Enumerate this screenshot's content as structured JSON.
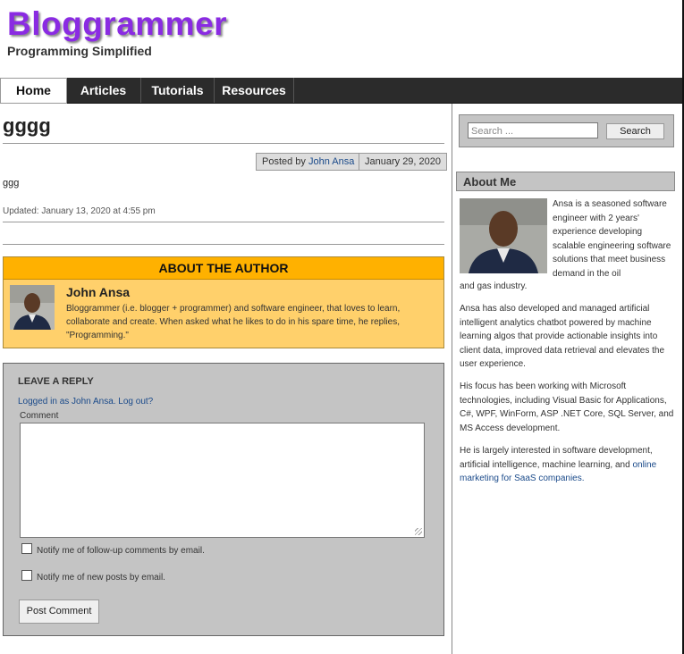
{
  "site": {
    "title": "Bloggrammer",
    "tagline": "Programming Simplified"
  },
  "nav": {
    "home": "Home",
    "articles": "Articles",
    "tutorials": "Tutorials",
    "resources": "Resources"
  },
  "post": {
    "title": "gggg",
    "posted_by_prefix": "Posted by",
    "author": "John Ansa",
    "date": "January 29, 2020",
    "body": "ggg",
    "updated": "Updated: January 13, 2020 at 4:55 pm"
  },
  "author_box": {
    "header": "ABOUT THE AUTHOR",
    "name": "John Ansa",
    "bio": "Bloggrammer (i.e. blogger + programmer) and software engineer, that loves to learn, collaborate and create. When asked what he likes to do in his spare time, he replies, \"Programming.\""
  },
  "reply": {
    "title": "LEAVE A REPLY",
    "logged_in": "Logged in as John Ansa. Log out?",
    "comment_label": "Comment",
    "notify_comments": "Notify me of follow-up comments by email.",
    "notify_posts": "Notify me of new posts by email.",
    "submit": "Post Comment"
  },
  "sidebar": {
    "search_placeholder": "Search ...",
    "search_button": "Search",
    "about_title": "About Me",
    "about_p1": "Ansa is a seasoned software engineer with 2 years' experience developing scalable engineering software solutions that meet business demand in the oil",
    "about_p1_cont": "and gas industry.",
    "about_p2": "Ansa has also developed and managed artificial intelligent analytics chatbot powered by machine learning algos that provide actionable insights into client data, improved data retrieval and elevates the user experience.",
    "about_p3": "His focus has been working with Microsoft technologies, including Visual Basic for Applications, C#, WPF, WinForm, ASP .NET Core, SQL Server, and MS Access development.",
    "about_p4": "He is largely interested in software development, artificial intelligence, machine learning, and",
    "about_p4_link": "online marketing for SaaS companies."
  },
  "colors": {
    "brand": "#8a2be2",
    "nav_bg": "#2b2b2b",
    "author_header": "#ffb100",
    "author_bg": "#ffd06b",
    "link": "#1a4a8a"
  }
}
